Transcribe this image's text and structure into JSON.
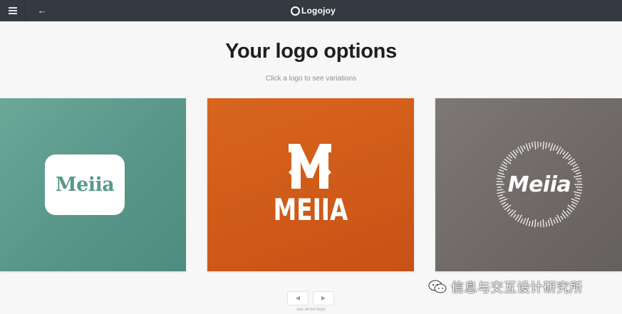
{
  "topbar": {
    "menu_icon": "hamburger-menu-icon",
    "back_icon": "arrow-left-icon",
    "back_glyph": "←",
    "brand_name": "Logojoy",
    "background": "#343a42"
  },
  "main": {
    "title": "Your logo options",
    "subtitle": "Click a logo to see variations"
  },
  "logos": [
    {
      "text": "Meiia",
      "style": "serif-badge",
      "background": "#5a988a"
    },
    {
      "text": "MEIIA",
      "style": "monogram-m",
      "background": "#d25b17"
    },
    {
      "text": "Meiia",
      "style": "radial-ring",
      "background": "#726c6a"
    }
  ],
  "navigation": {
    "prev_glyph": "◀",
    "next_glyph": "▶",
    "hint": "use arrow keys"
  },
  "watermark": {
    "text": "信息与交互设计研究所",
    "icon": "wechat-icon"
  }
}
